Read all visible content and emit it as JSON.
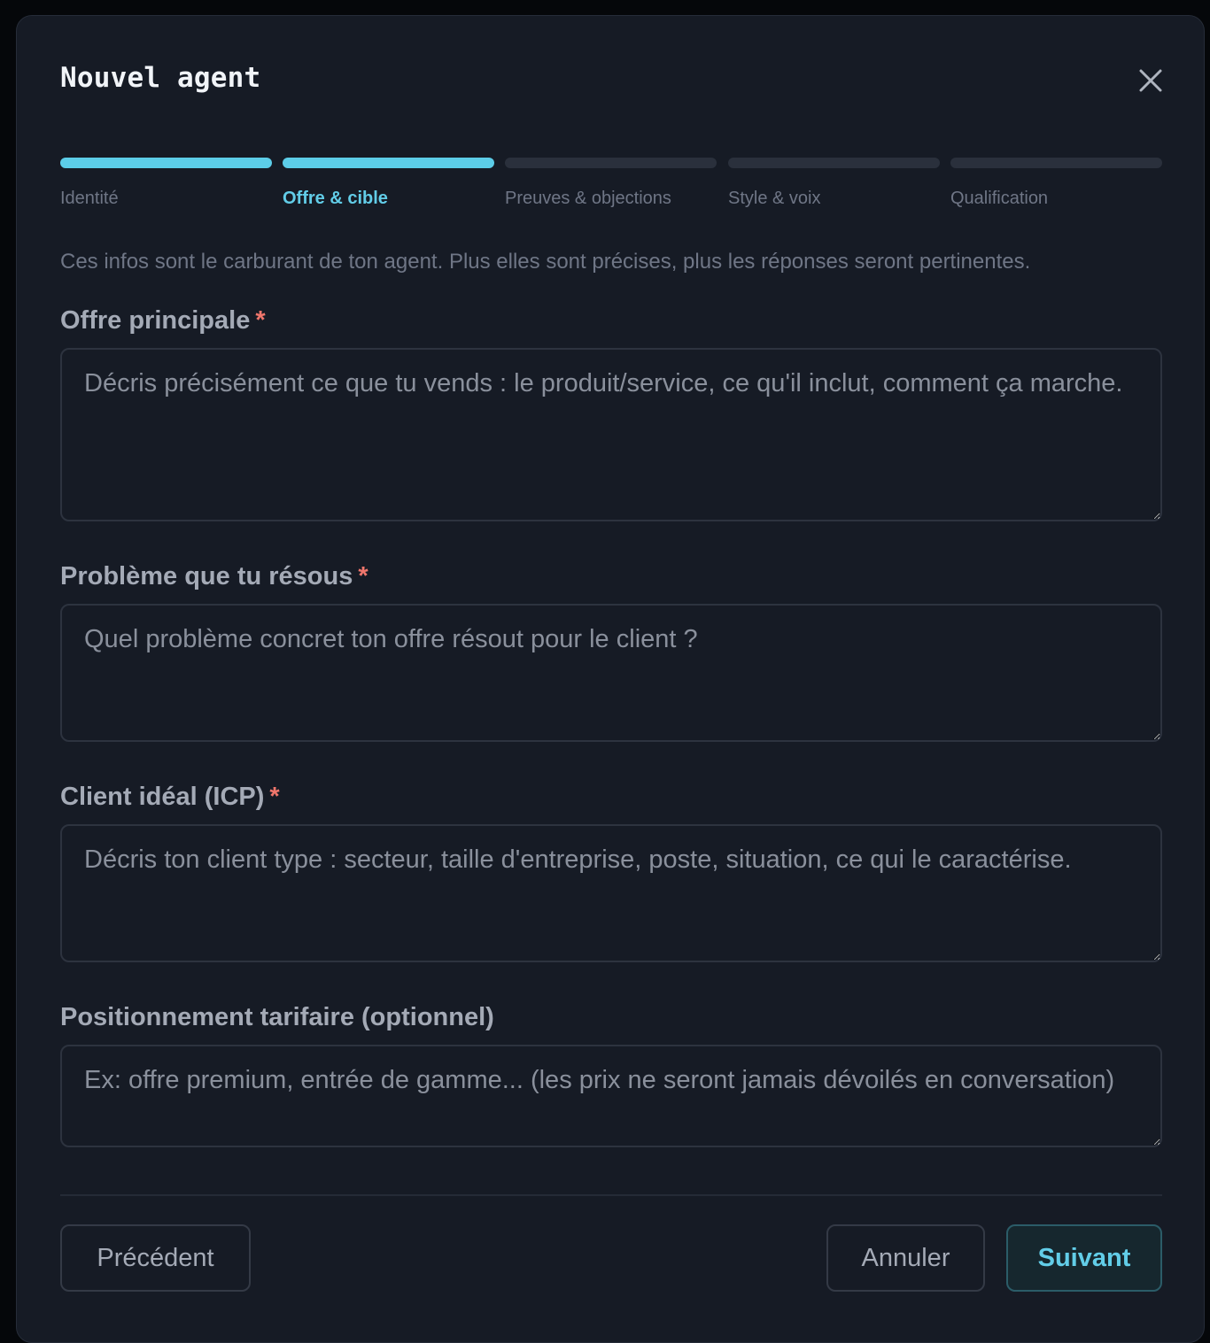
{
  "dialog": {
    "title": "Nouvel agent",
    "close_icon": "close-icon"
  },
  "steps": [
    {
      "label": "Identité",
      "completed": true,
      "current": false
    },
    {
      "label": "Offre & cible",
      "completed": true,
      "current": true
    },
    {
      "label": "Preuves & objections",
      "completed": false,
      "current": false
    },
    {
      "label": "Style & voix",
      "completed": false,
      "current": false
    },
    {
      "label": "Qualification",
      "completed": false,
      "current": false
    }
  ],
  "intro": "Ces infos sont le carburant de ton agent. Plus elles sont précises, plus les réponses seront pertinentes.",
  "fields": {
    "offre": {
      "label": "Offre principale",
      "required_mark": "*",
      "value": "",
      "placeholder": "Décris précisément ce que tu vends : le produit/service, ce qu'il inclut, comment ça marche."
    },
    "probleme": {
      "label": "Problème que tu résous",
      "required_mark": "*",
      "value": "",
      "placeholder": "Quel problème concret ton offre résout pour le client ?"
    },
    "icp": {
      "label": "Client idéal (ICP)",
      "required_mark": "*",
      "value": "",
      "placeholder": "Décris ton client type : secteur, taille d'entreprise, poste, situation, ce qui le caractérise."
    },
    "tarif": {
      "label": "Positionnement tarifaire (optionnel)",
      "value": "",
      "placeholder": "Ex: offre premium, entrée de gamme... (les prix ne seront jamais dévoilés en conversation)"
    }
  },
  "footer": {
    "prev_label": "Précédent",
    "cancel_label": "Annuler",
    "next_label": "Suivant"
  },
  "colors": {
    "accent": "#5ccde8",
    "required": "#f0766c",
    "background": "#161b25"
  }
}
